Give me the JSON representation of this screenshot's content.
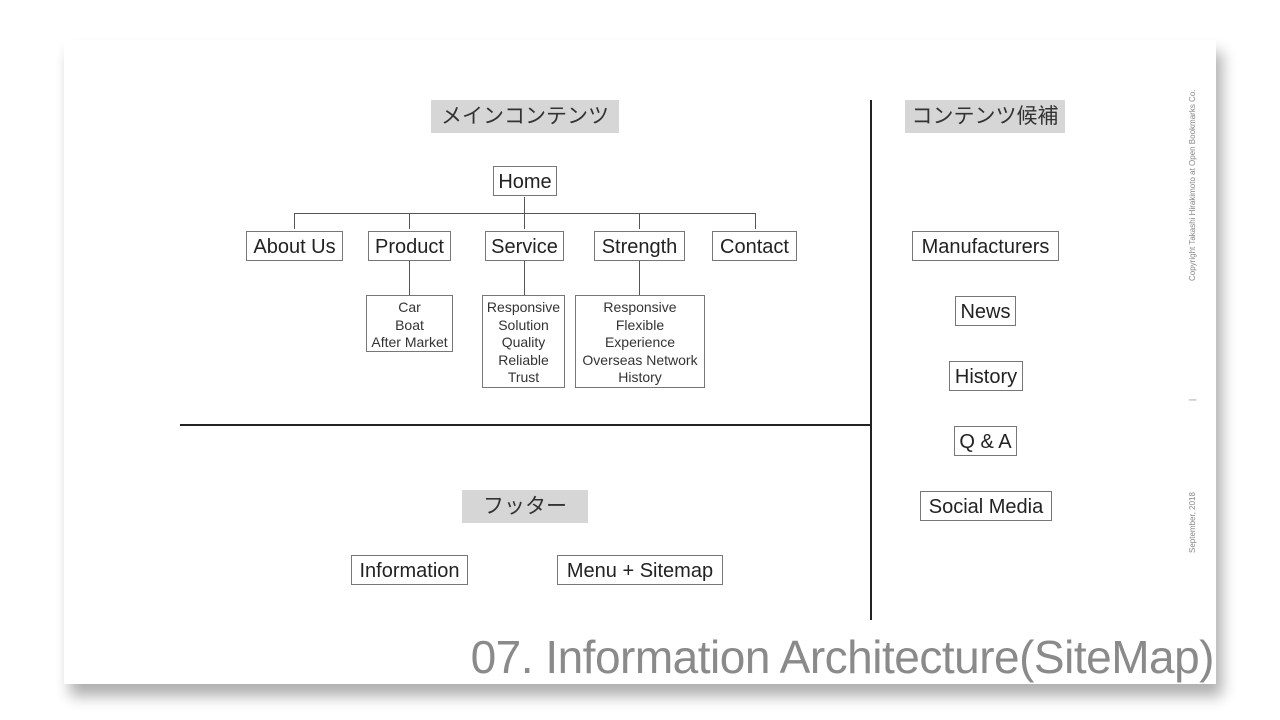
{
  "slide": {
    "title": "07. Information Architecture(SiteMap)",
    "copyright": "Copyright Takashi Hirakimoto at Open Bookmarks Co.",
    "separator": "|",
    "date": "September, 2018"
  },
  "main": {
    "label": "メインコンテンツ",
    "root": "Home",
    "children": [
      {
        "label": "About Us",
        "items": []
      },
      {
        "label": "Product",
        "items": [
          "Car",
          "Boat",
          "After Market"
        ]
      },
      {
        "label": "Service",
        "items": [
          "Responsive",
          "Solution",
          "Quality",
          "Reliable",
          "Trust"
        ]
      },
      {
        "label": "Strength",
        "items": [
          "Responsive",
          "Flexible",
          "Experience",
          "Overseas Network",
          "History"
        ]
      },
      {
        "label": "Contact",
        "items": []
      }
    ]
  },
  "candidates": {
    "label": "コンテンツ候補",
    "items": [
      "Manufacturers",
      "News",
      "History",
      "Q & A",
      "Social Media"
    ]
  },
  "footer": {
    "label": "フッター",
    "items": [
      "Information",
      "Menu + Sitemap"
    ]
  },
  "colors": {
    "label_bg": "#d6d6d6",
    "border": "#777777",
    "title": "#8a8a8a"
  }
}
